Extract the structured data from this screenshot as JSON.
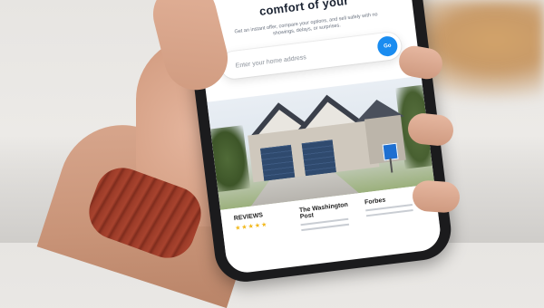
{
  "screen": {
    "headline": "comfort of your",
    "subtext": "Get an instant offer, compare your options, and sell safely with no showings, delays, or surprises.",
    "search": {
      "placeholder": "Enter your home address",
      "button_label": "Go"
    },
    "press": [
      {
        "name": "REVIEWS",
        "stars": "★★★★★"
      },
      {
        "name": "The Washington Post",
        "stars": ""
      },
      {
        "name": "Forbes",
        "stars": ""
      }
    ]
  },
  "colors": {
    "accent": "#1a8cf0",
    "garage_door": "#2f4a6e",
    "bracelet": "#9b3b28"
  }
}
